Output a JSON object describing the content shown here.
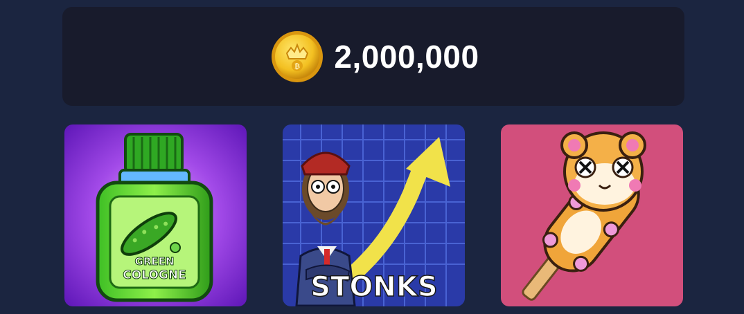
{
  "balance": {
    "icon": "coin-icon",
    "value": "2,000,000",
    "coin_color": "#f3c021"
  },
  "cards": [
    {
      "name": "green-cologne",
      "image_text_line1": "GREEN",
      "image_text_line2": "COLOGNE",
      "bg_color": "#8a2fd6"
    },
    {
      "name": "stonks",
      "image_text": "STONKS",
      "bg_color": "#2a3aa8"
    },
    {
      "name": "hamster-popsicle",
      "bg_color": "#d24f7c"
    }
  ]
}
